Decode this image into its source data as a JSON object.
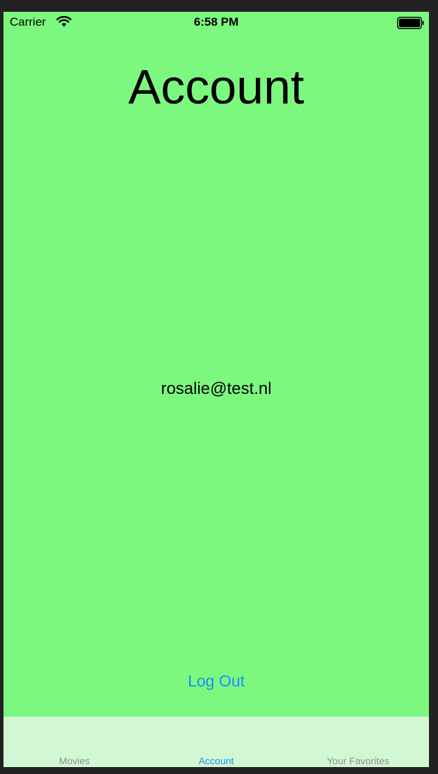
{
  "status_bar": {
    "carrier": "Carrier",
    "time": "6:58 PM"
  },
  "page": {
    "title": "Account",
    "email": "rosalie@test.nl",
    "logout_label": "Log Out"
  },
  "tab_bar": {
    "tabs": [
      {
        "label": "Movies",
        "active": false
      },
      {
        "label": "Account",
        "active": true
      },
      {
        "label": "Your Favorites",
        "active": false
      }
    ]
  },
  "colors": {
    "background": "#7cf87f",
    "tab_bar_background": "#d2f8d3",
    "accent": "#1a8cff",
    "inactive_tab": "#8e8e93"
  },
  "icons": {
    "wifi": "wifi-icon",
    "battery": "battery-icon"
  }
}
